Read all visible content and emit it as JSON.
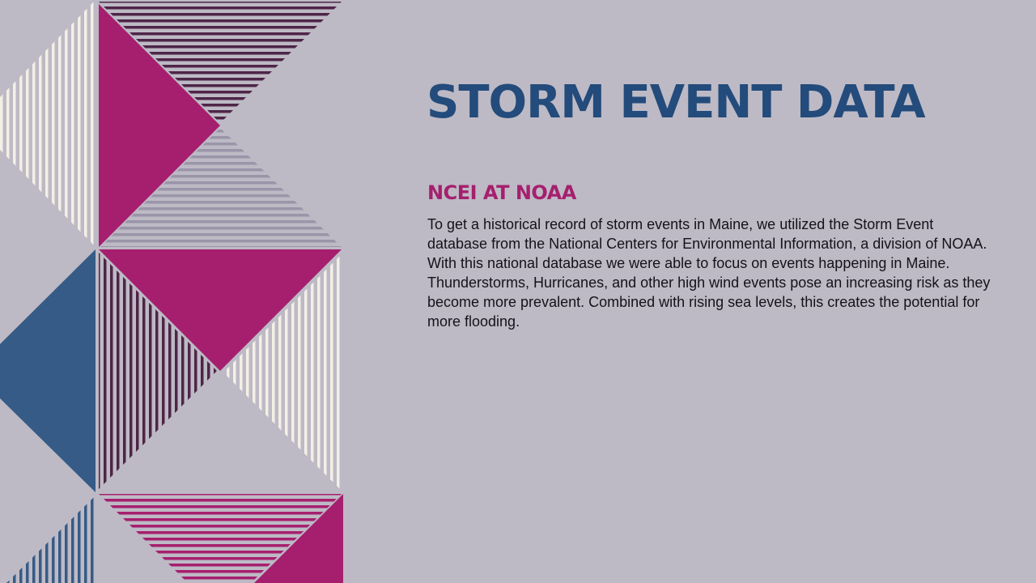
{
  "slide": {
    "title": "STORM EVENT DATA",
    "subtitle": "NCEI AT NOAA",
    "body": "To get a historical record of storm events in Maine, we utilized the Storm Event database from the National Centers for Environmental Information, a division of NOAA. With this national database we were able to focus on events happening in Maine. Thunderstorms, Hurricanes, and other high wind events pose an increasing risk as they become more prevalent. Combined with rising sea levels, this creates the potential for more flooding."
  },
  "colors": {
    "background": "#bdbac5",
    "title": "#234b7b",
    "subtitle": "#a61f6e",
    "body_text": "#15121a",
    "magenta": "#a61f6e",
    "navy": "#365b86",
    "plum_stripe": "#4e2548",
    "cream_stripe": "#f4efe6",
    "lavender_stripe": "#9a95a8"
  },
  "decoration": {
    "style": "geometric triangle pattern with striped fills"
  }
}
